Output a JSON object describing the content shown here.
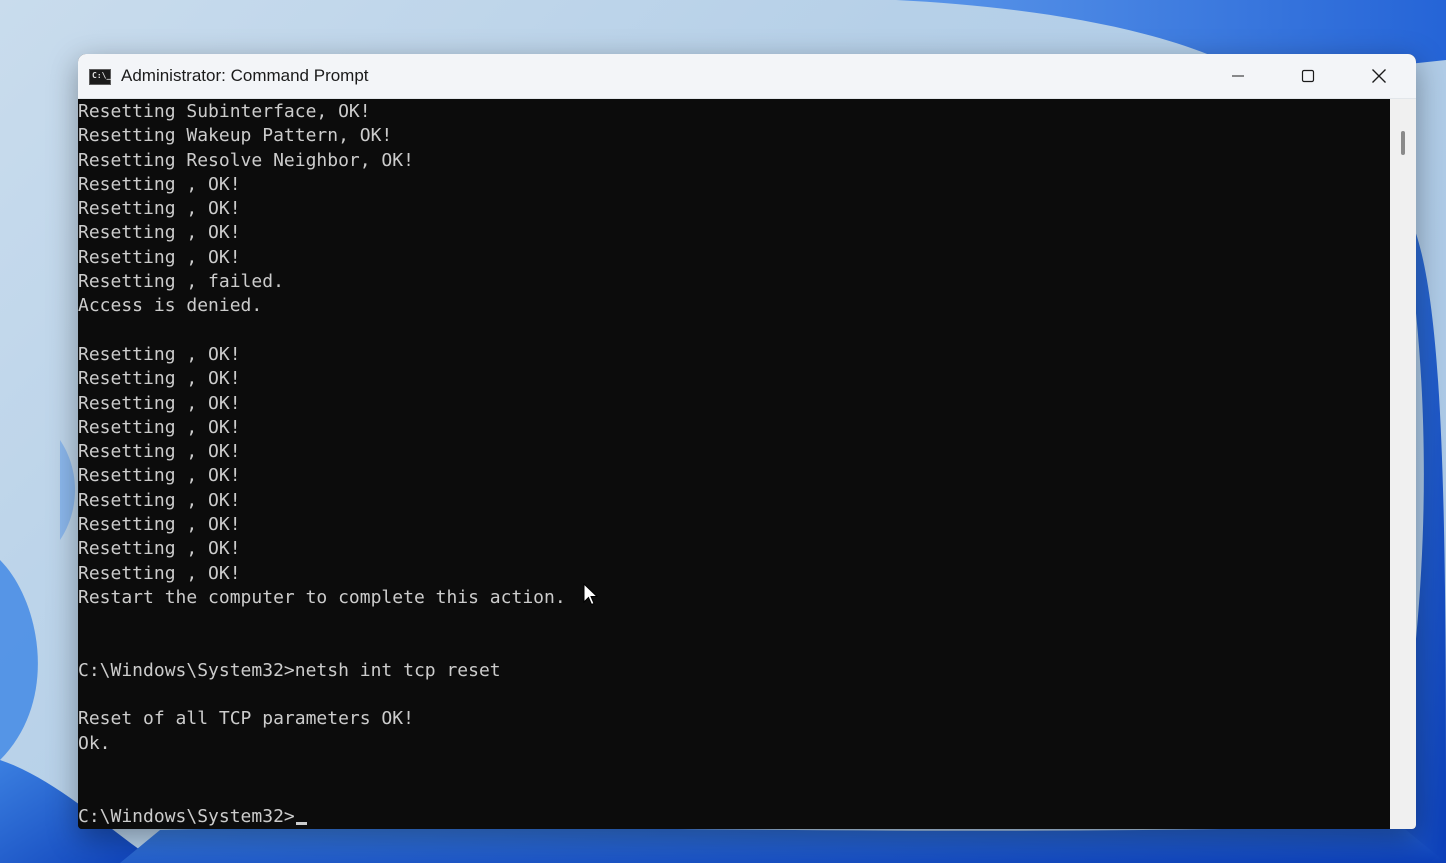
{
  "window": {
    "title": "Administrator: Command Prompt",
    "icon": "cmd-icon",
    "icon_glyph": "C:\\_",
    "controls": [
      "minimize-icon",
      "maximize-icon",
      "close-icon"
    ]
  },
  "console": {
    "lines": [
      "Resetting Subinterface, OK!",
      "Resetting Wakeup Pattern, OK!",
      "Resetting Resolve Neighbor, OK!",
      "Resetting , OK!",
      "Resetting , OK!",
      "Resetting , OK!",
      "Resetting , OK!",
      "Resetting , failed.",
      "Access is denied.",
      "",
      "Resetting , OK!",
      "Resetting , OK!",
      "Resetting , OK!",
      "Resetting , OK!",
      "Resetting , OK!",
      "Resetting , OK!",
      "Resetting , OK!",
      "Resetting , OK!",
      "Resetting , OK!",
      "Resetting , OK!",
      "Restart the computer to complete this action.",
      "",
      "",
      "C:\\Windows\\System32>netsh int tcp reset",
      "",
      "Reset of all TCP parameters OK!",
      "Ok.",
      "",
      ""
    ],
    "prompt": "C:\\Windows\\System32>",
    "input_value": ""
  },
  "colors": {
    "console_bg": "#0c0c0c",
    "console_fg": "#cccccc",
    "titlebar_bg": "#f3f5f8"
  }
}
